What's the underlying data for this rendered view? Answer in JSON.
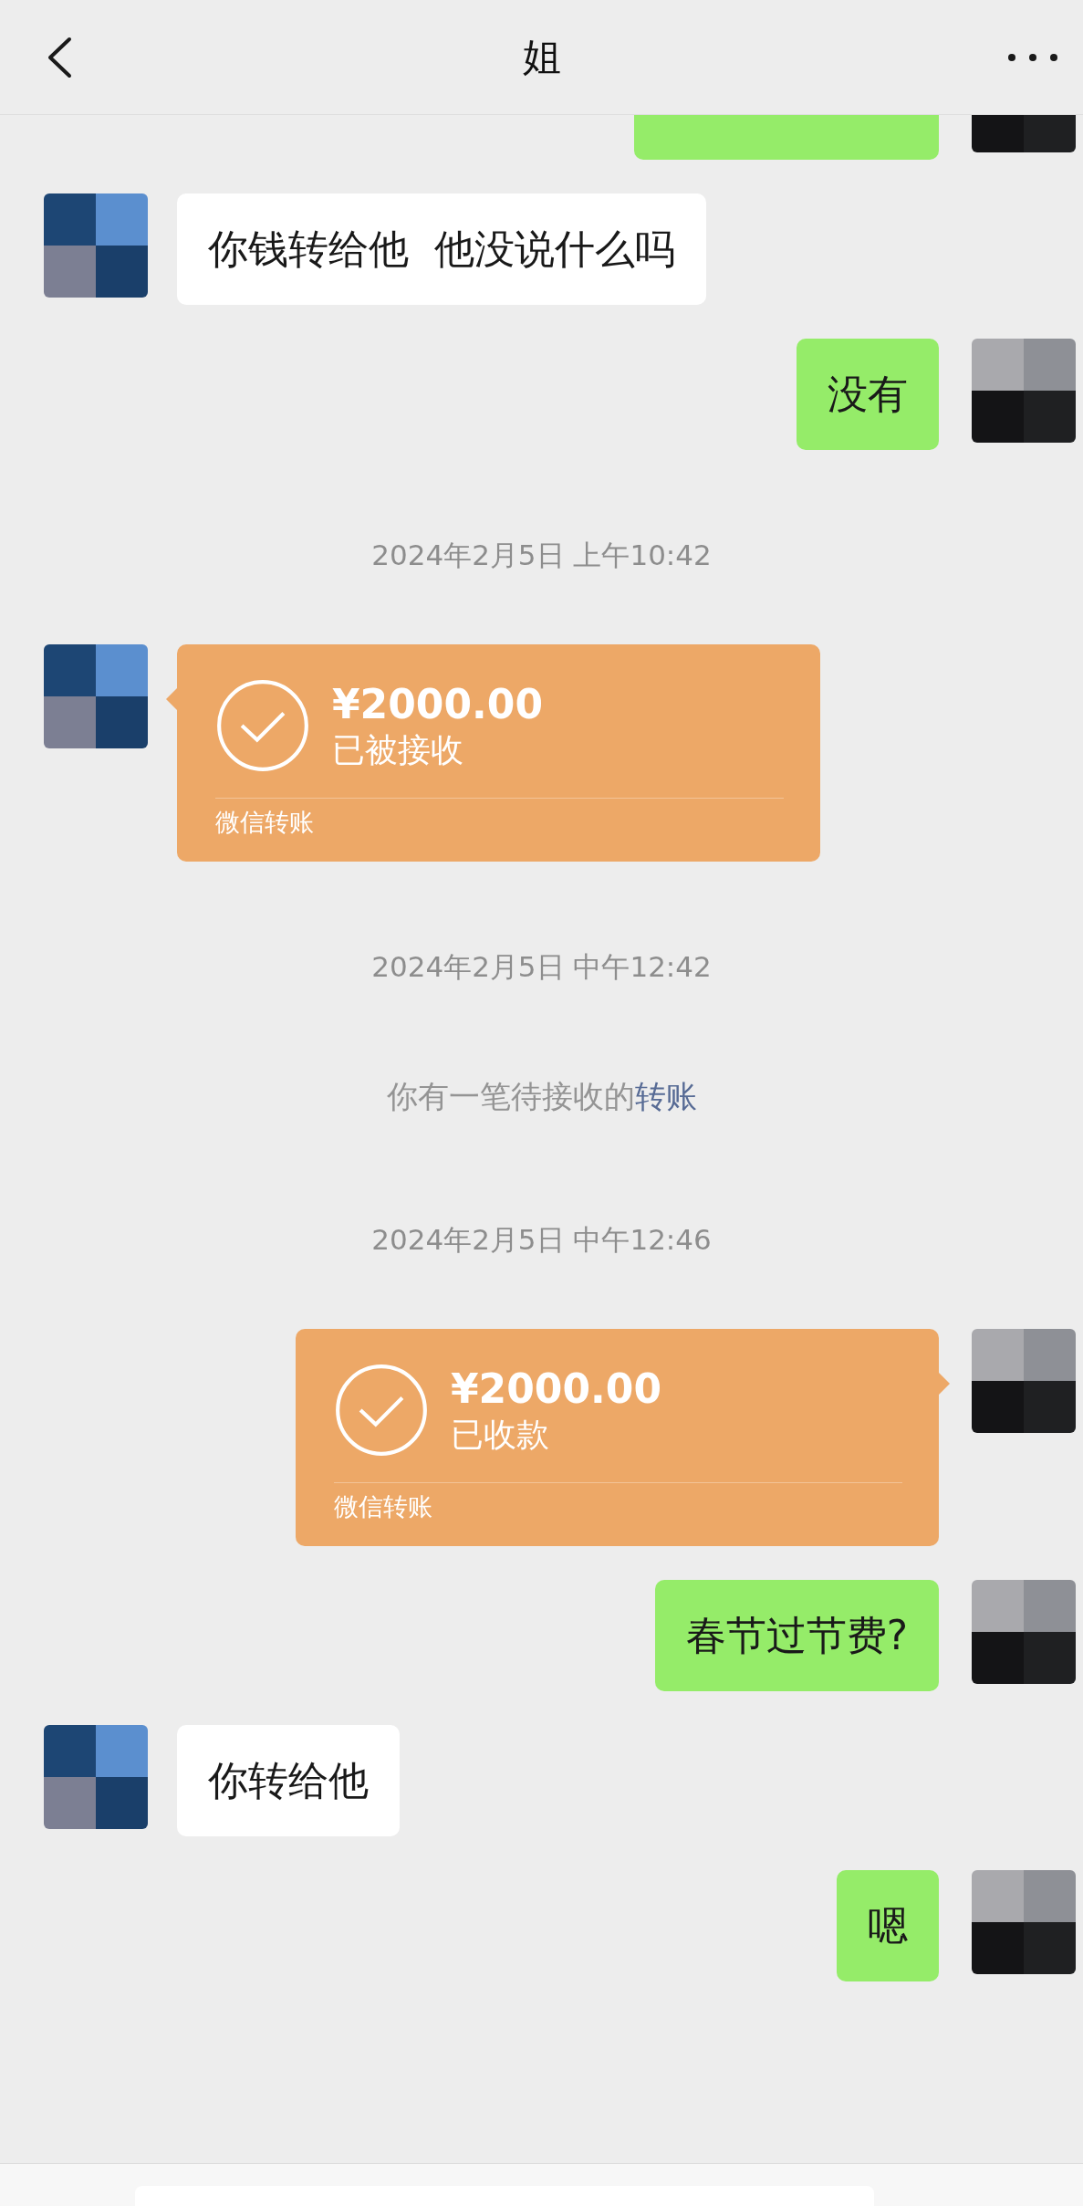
{
  "header": {
    "title": "姐"
  },
  "items": [
    {
      "kind": "cut",
      "outgoing": true
    },
    {
      "kind": "text",
      "outgoing": false,
      "text": "你钱转给他  他没说什么吗"
    },
    {
      "kind": "text",
      "outgoing": true,
      "text": "没有"
    },
    {
      "kind": "time",
      "text": "2024年2月5日 上午10:42"
    },
    {
      "kind": "transfer",
      "outgoing": false,
      "amount": "¥2000.00",
      "status": "已被接收",
      "label": "微信转账"
    },
    {
      "kind": "time",
      "text": "2024年2月5日 中午12:42"
    },
    {
      "kind": "system",
      "text": "你有一笔待接收的",
      "link": "转账"
    },
    {
      "kind": "time",
      "text": "2024年2月5日 中午12:46"
    },
    {
      "kind": "transfer",
      "outgoing": true,
      "amount": "¥2000.00",
      "status": "已收款",
      "label": "微信转账"
    },
    {
      "kind": "text",
      "outgoing": true,
      "text": "春节过节费?"
    },
    {
      "kind": "text",
      "outgoing": false,
      "text": "你转给他"
    },
    {
      "kind": "text",
      "outgoing": true,
      "text": "嗯"
    }
  ]
}
